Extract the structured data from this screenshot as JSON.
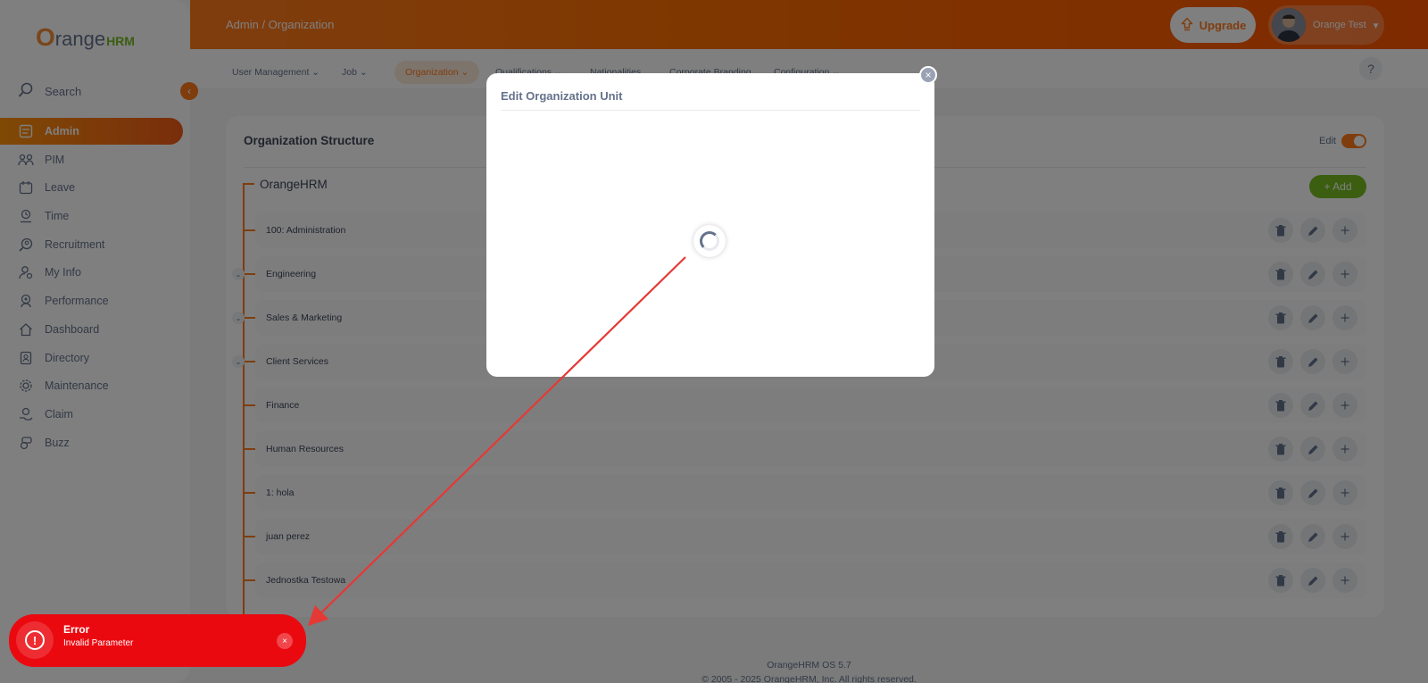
{
  "app": {
    "logo_main": "range",
    "logo_o": "O",
    "logo_hrm": "HRM"
  },
  "sidebar": {
    "search_label": "Search",
    "collapse_icon": "chevron-left-icon",
    "items": [
      {
        "label": "Admin",
        "icon": "admin-icon",
        "active": true
      },
      {
        "label": "PIM",
        "icon": "pim-icon"
      },
      {
        "label": "Leave",
        "icon": "leave-icon"
      },
      {
        "label": "Time",
        "icon": "time-icon"
      },
      {
        "label": "Recruitment",
        "icon": "recruitment-icon"
      },
      {
        "label": "My Info",
        "icon": "myinfo-icon"
      },
      {
        "label": "Performance",
        "icon": "performance-icon"
      },
      {
        "label": "Dashboard",
        "icon": "dashboard-icon"
      },
      {
        "label": "Directory",
        "icon": "directory-icon"
      },
      {
        "label": "Maintenance",
        "icon": "maintenance-icon"
      },
      {
        "label": "Claim",
        "icon": "claim-icon"
      },
      {
        "label": "Buzz",
        "icon": "buzz-icon"
      }
    ]
  },
  "header": {
    "breadcrumb": "Admin / Organization",
    "upgrade_label": "Upgrade",
    "user_name": "Orange Test"
  },
  "subnav": {
    "items": [
      {
        "label": "User Management"
      },
      {
        "label": "Job"
      },
      {
        "label": "Organization",
        "active": true
      },
      {
        "label": "Qualifications"
      },
      {
        "label": "Nationalities"
      },
      {
        "label": "Corporate Branding"
      },
      {
        "label": "Configuration"
      }
    ],
    "help_label": "?"
  },
  "org": {
    "title": "Organization Structure",
    "edit_label": "Edit",
    "root": "OrangeHRM",
    "add_label": "+ Add",
    "units": [
      {
        "label": "100: Administration",
        "expandable": false
      },
      {
        "label": "Engineering",
        "expandable": true
      },
      {
        "label": "Sales & Marketing",
        "expandable": true
      },
      {
        "label": "Client Services",
        "expandable": true
      },
      {
        "label": "Finance",
        "expandable": false
      },
      {
        "label": "Human Resources",
        "expandable": false
      },
      {
        "label": "1: hola",
        "expandable": false
      },
      {
        "label": "juan perez",
        "expandable": false
      },
      {
        "label": "Jednostka Testowa",
        "expandable": false
      }
    ]
  },
  "footer": {
    "version": "OrangeHRM OS 5.7",
    "copyright": "© 2005 - 2025 OrangeHRM, Inc. All rights reserved."
  },
  "modal": {
    "title": "Edit Organization Unit",
    "close_label": "×"
  },
  "toast": {
    "title": "Error",
    "message": "Invalid Parameter",
    "close_label": "×"
  },
  "colors": {
    "accent": "#ff7b1d",
    "success": "#76bc21",
    "error": "#eb0910",
    "arrow": "#e53935"
  }
}
